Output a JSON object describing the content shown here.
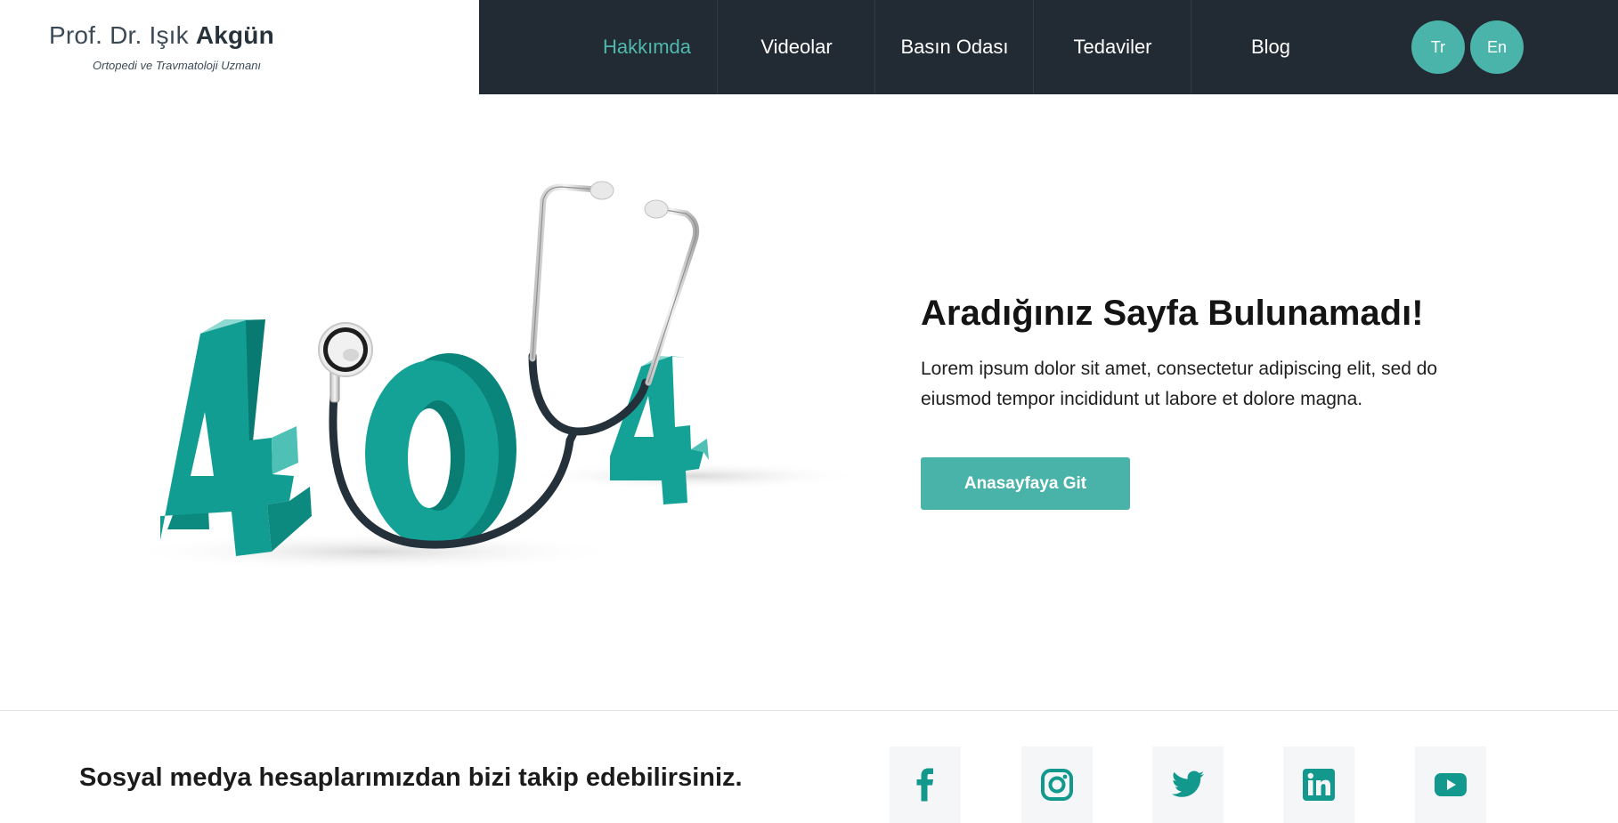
{
  "brand": {
    "name_prefix": "Prof. Dr. Işık",
    "name_bold": "Akgün",
    "subtitle": "Ortopedi ve Travmatoloji Uzmanı"
  },
  "nav": {
    "items": [
      {
        "label": "Hakkımda",
        "active": true
      },
      {
        "label": "Videolar",
        "active": false
      },
      {
        "label": "Basın Odası",
        "active": false
      },
      {
        "label": "Tedaviler",
        "active": false
      },
      {
        "label": "Blog",
        "active": false
      }
    ],
    "languages": [
      "Tr",
      "En"
    ]
  },
  "error_page": {
    "illustration_icon": "stethoscope-404-illustration",
    "headline": "Aradığınız Sayfa Bulunamadı!",
    "description": "Lorem ipsum dolor sit amet, consectetur adipiscing elit, sed do eiusmod tempor incididunt ut labore et dolore magna.",
    "button_label": "Anasayfaya Git"
  },
  "footer": {
    "follow_text": "Sosyal medya hesaplarımızdan bizi takip edebilirsiniz.",
    "social_icons": [
      "facebook-icon",
      "instagram-icon",
      "twitter-icon",
      "linkedin-icon",
      "youtube-icon"
    ]
  },
  "colors": {
    "accent": "#4ab3aa",
    "nav_background": "#222b34",
    "icon_teal": "#12988d"
  }
}
